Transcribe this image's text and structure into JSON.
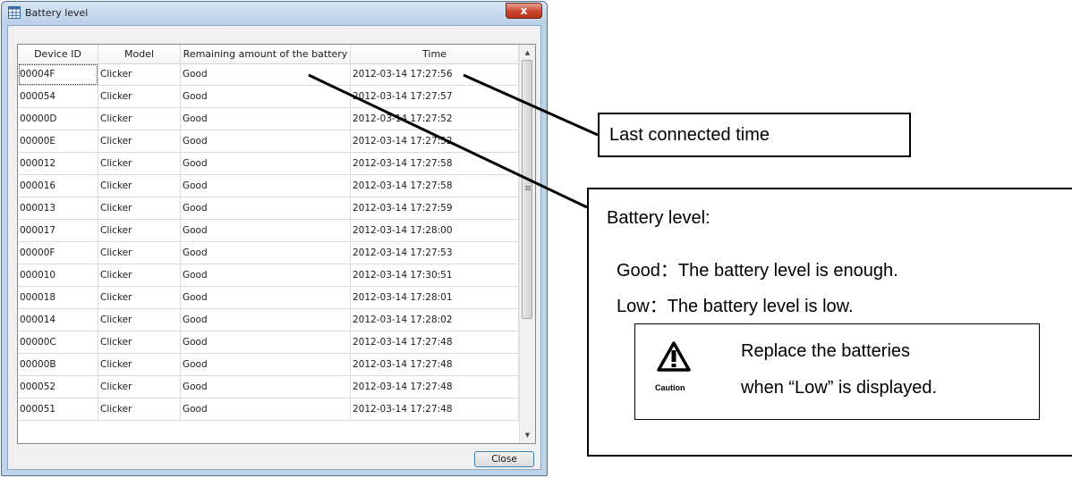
{
  "window": {
    "title": "Battery level",
    "close_glyph": "x",
    "close_button": "Close"
  },
  "table": {
    "columns": [
      "Device ID",
      "Model",
      "Remaining amount of the battery",
      "Time"
    ],
    "rows": [
      [
        "00004F",
        "Clicker",
        "Good",
        "2012-03-14 17:27:56"
      ],
      [
        "000054",
        "Clicker",
        "Good",
        "2012-03-14 17:27:57"
      ],
      [
        "00000D",
        "Clicker",
        "Good",
        "2012-03-14 17:27:52"
      ],
      [
        "00000E",
        "Clicker",
        "Good",
        "2012-03-14 17:27:52"
      ],
      [
        "000012",
        "Clicker",
        "Good",
        "2012-03-14 17:27:58"
      ],
      [
        "000016",
        "Clicker",
        "Good",
        "2012-03-14 17:27:58"
      ],
      [
        "000013",
        "Clicker",
        "Good",
        "2012-03-14 17:27:59"
      ],
      [
        "000017",
        "Clicker",
        "Good",
        "2012-03-14 17:28:00"
      ],
      [
        "00000F",
        "Clicker",
        "Good",
        "2012-03-14 17:27:53"
      ],
      [
        "000010",
        "Clicker",
        "Good",
        "2012-03-14 17:30:51"
      ],
      [
        "000018",
        "Clicker",
        "Good",
        "2012-03-14 17:28:01"
      ],
      [
        "000014",
        "Clicker",
        "Good",
        "2012-03-14 17:28:02"
      ],
      [
        "00000C",
        "Clicker",
        "Good",
        "2012-03-14 17:27:48"
      ],
      [
        "00000B",
        "Clicker",
        "Good",
        "2012-03-14 17:27:48"
      ],
      [
        "000052",
        "Clicker",
        "Good",
        "2012-03-14 17:27:48"
      ],
      [
        "000051",
        "Clicker",
        "Good",
        "2012-03-14 17:27:48"
      ]
    ]
  },
  "callouts": {
    "time_label": "Last connected time",
    "battery_title": "Battery level:",
    "good_line": "Good：The battery level is enough.",
    "low_line": "Low：The battery level is low.",
    "caution_word": "Caution",
    "caution_line1": "Replace the batteries",
    "caution_line2": "when “Low” is displayed."
  },
  "icons": {
    "app": "grid-icon",
    "caution": "warning-triangle-icon",
    "scroll_up": "chevron-up-icon",
    "scroll_down": "chevron-down-icon"
  }
}
